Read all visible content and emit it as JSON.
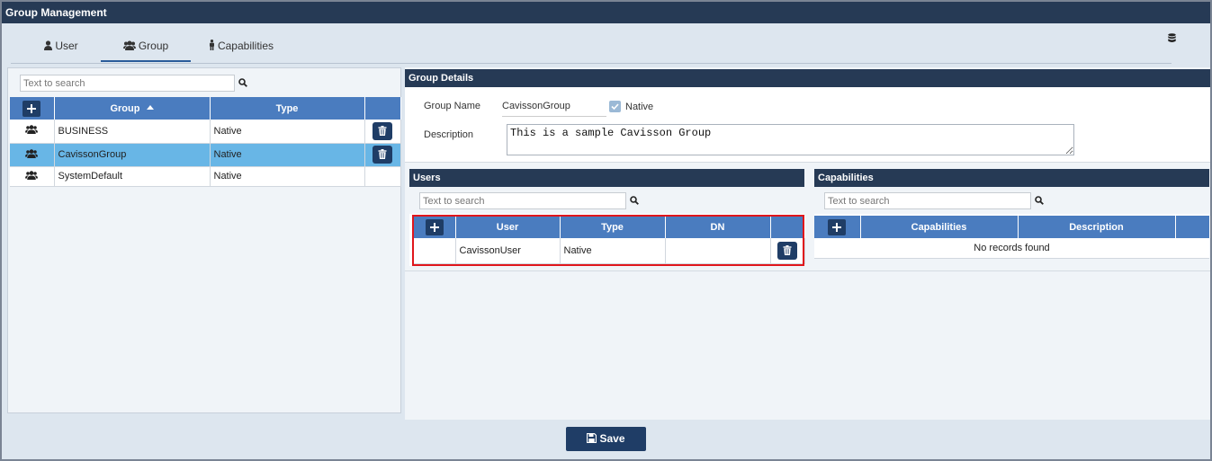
{
  "window": {
    "title": "Group Management"
  },
  "tabs": [
    {
      "label": "User",
      "icon": "user-icon"
    },
    {
      "label": "Group",
      "icon": "users-icon",
      "active": true
    },
    {
      "label": "Capabilities",
      "icon": "male-icon"
    }
  ],
  "groups_panel": {
    "search_placeholder": "Text to search",
    "columns": [
      "Group",
      "Type"
    ],
    "rows": [
      {
        "group": "BUSINESS",
        "type": "Native"
      },
      {
        "group": "CavissonGroup",
        "type": "Native",
        "selected": true
      },
      {
        "group": "SystemDefault",
        "type": "Native"
      }
    ]
  },
  "group_details": {
    "heading": "Group Details",
    "name_label": "Group Name",
    "name_value": "CavissonGroup",
    "native_label": "Native",
    "native_checked": true,
    "description_label": "Description",
    "description_value": "This is a sample Cavisson Group"
  },
  "users_panel": {
    "heading": "Users",
    "search_placeholder": "Text to search",
    "columns": [
      "User",
      "Type",
      "DN"
    ],
    "rows": [
      {
        "user": "CavissonUser",
        "type": "Native",
        "dn": ""
      }
    ]
  },
  "capabilities_panel": {
    "heading": "Capabilities",
    "search_placeholder": "Text to search",
    "columns": [
      "Capabilities",
      "Description"
    ],
    "empty_text": "No records found"
  },
  "footer": {
    "save_label": "Save"
  },
  "colors": {
    "header_bg": "#263a55",
    "table_header": "#4a7cbf",
    "selected_row": "#68b6e6",
    "button_bg": "#1f3d66",
    "highlight": "#e0161c"
  }
}
